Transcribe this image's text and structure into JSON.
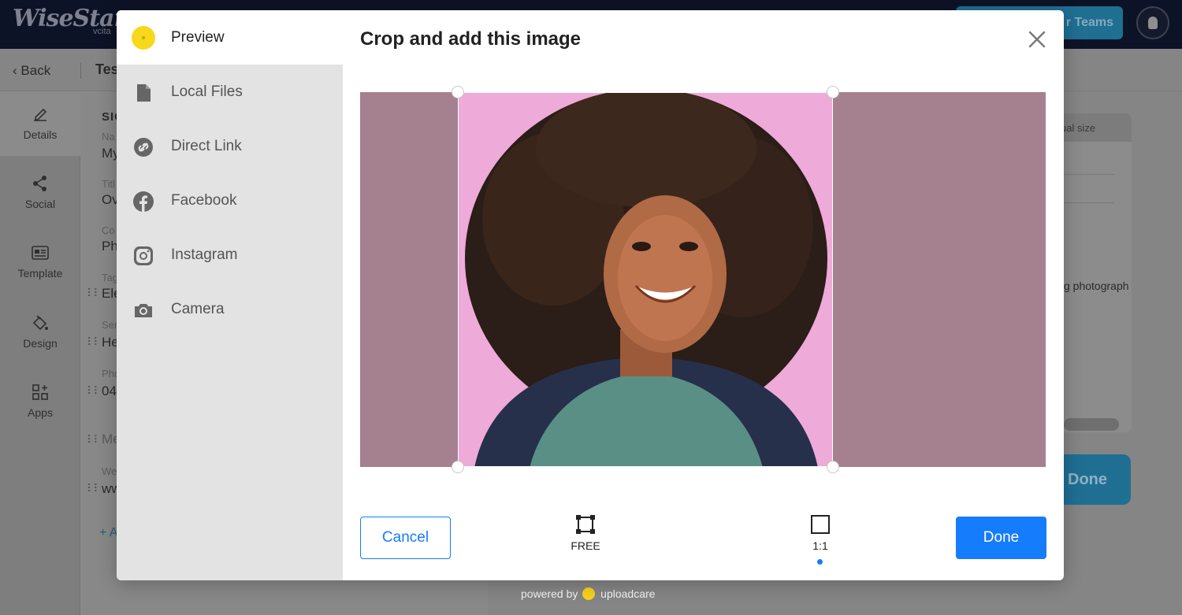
{
  "background": {
    "logo": "WiseStamp",
    "logo_sub": "vcita",
    "teams_button": "r Teams",
    "back_label": "Back",
    "page_title": "Tes",
    "sidebar": [
      {
        "label": "Details",
        "icon": "pencil-icon"
      },
      {
        "label": "Social",
        "icon": "share-icon"
      },
      {
        "label": "Template",
        "icon": "template-icon"
      },
      {
        "label": "Design",
        "icon": "paint-bucket-icon"
      },
      {
        "label": "Apps",
        "icon": "apps-grid-icon"
      }
    ],
    "form": {
      "section_title": "SIG",
      "fields": [
        {
          "label": "Na",
          "value": "My"
        },
        {
          "label": "Titl",
          "value": "Ov"
        },
        {
          "label": "Co",
          "value": "Ph"
        },
        {
          "label": "Tag",
          "value": "Ele"
        },
        {
          "label": "Ser",
          "value": "He"
        },
        {
          "label": "Pho",
          "value": "04"
        },
        {
          "label": "",
          "value": "Me"
        },
        {
          "label": "We",
          "value": "ww"
        }
      ],
      "add_link": "+ A"
    },
    "preview": {
      "header": "ual size",
      "text": "g photograph"
    },
    "done_button": "Done"
  },
  "modal": {
    "title": "Crop and add this image",
    "sources": [
      {
        "label": "Preview",
        "icon": "uploadcare-dot-icon",
        "active": true
      },
      {
        "label": "Local Files",
        "icon": "file-icon"
      },
      {
        "label": "Direct Link",
        "icon": "link-icon"
      },
      {
        "label": "Facebook",
        "icon": "facebook-icon"
      },
      {
        "label": "Instagram",
        "icon": "instagram-icon"
      },
      {
        "label": "Camera",
        "icon": "camera-icon"
      }
    ],
    "crop_options": [
      {
        "label": "FREE",
        "icon": "free-crop-icon"
      },
      {
        "label": "1:1",
        "icon": "square-crop-icon",
        "selected": true
      }
    ],
    "cancel_label": "Cancel",
    "done_label": "Done",
    "close_icon": "close-icon"
  },
  "footer": {
    "powered_prefix": "powered by",
    "powered_brand": "uploadcare"
  },
  "colors": {
    "accent": "#157cfc",
    "brand_yellow": "#f8d81b",
    "crop_background": "#a5808f",
    "photo_background": "#eeaad8"
  }
}
